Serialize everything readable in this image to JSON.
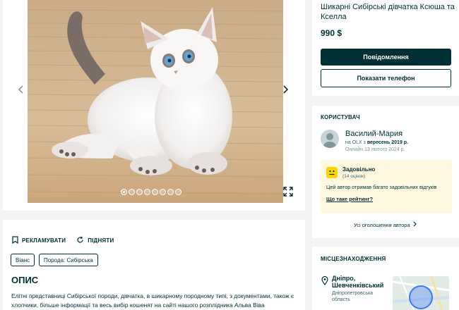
{
  "gallery": {
    "slide_count": 8,
    "active_slide": 1
  },
  "listing": {
    "title": "Шикарні Сибірські дівчатка Ксюша та Кселла",
    "price": "990 $",
    "message_label": "Повідомлення",
    "phone_label": "Показати телефон",
    "promote_label": "РЕКЛАМУВАТИ",
    "raise_label": "ПІДНЯТИ",
    "tags": [
      "Віанс",
      "Порода: Сибірська"
    ],
    "description_heading": "ОПИС",
    "description_text": "Елітні представниці Сибірської породи, дівчатка, в шикарному породному типі, з документами, також є хлопчики, більше інформації та весь вибір кошенят на сайті нашого розплідника Альва Віва"
  },
  "user": {
    "heading": "КОРИСТУВАЧ",
    "name": "Василий-Мария",
    "since_prefix": "на OLX з",
    "since_date": "вересень 2019 р.",
    "online": "Онлайн 13 лютого 2024 р.",
    "rating_label": "Задовільно",
    "rating_count": "(14 оцінок)",
    "rating_note": "Цей автор отримав багато задовільних відгуків",
    "rating_link": "Що таке рейтинг?",
    "all_ads_label": "Усі оголошення автора"
  },
  "location": {
    "heading": "МІСЦЕЗНАХОДЖЕННЯ",
    "city": "Дніпро, Шевченківський",
    "region": "Дніпропетровська область"
  },
  "colors": {
    "primary": "#002f34",
    "rating_bg": "#fff8e0",
    "rating_face": "#ffd500",
    "page_bg": "#f2f4f5"
  }
}
